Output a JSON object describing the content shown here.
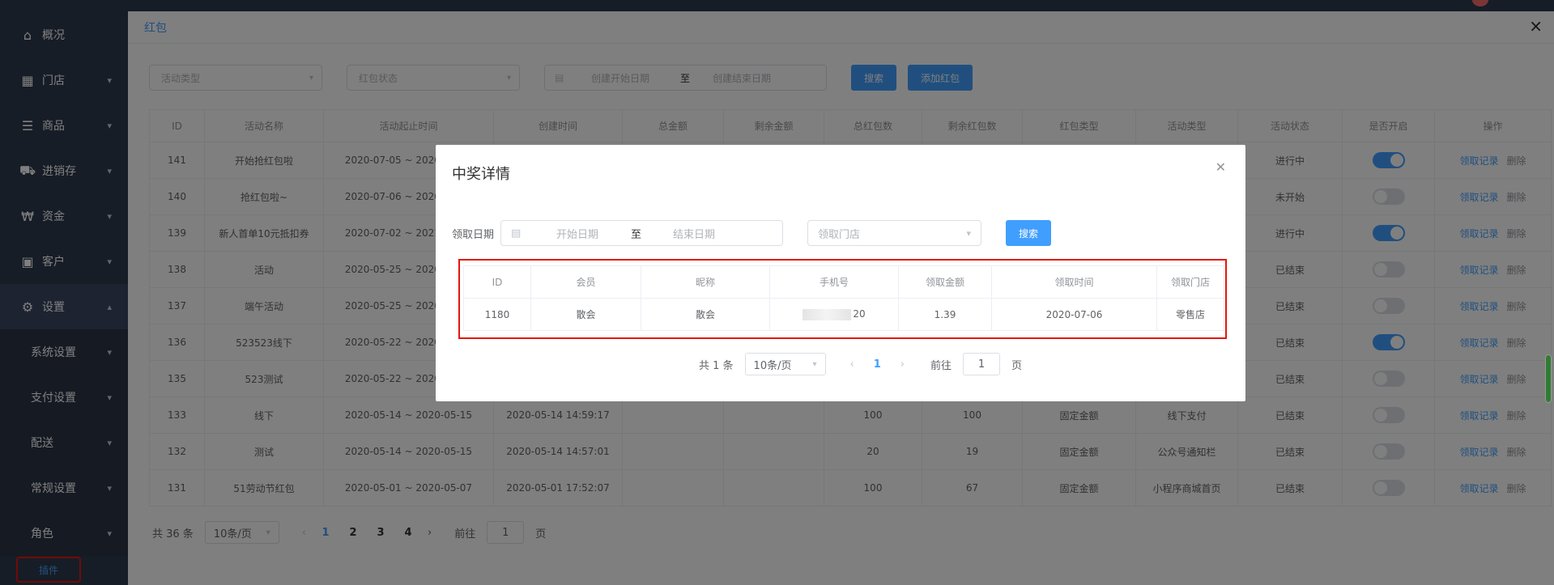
{
  "sidebar": {
    "items": [
      {
        "label": "概况",
        "icon": "home-icon"
      },
      {
        "label": "门店",
        "icon": "building-icon"
      },
      {
        "label": "商品",
        "icon": "list-icon"
      },
      {
        "label": "进销存",
        "icon": "truck-icon"
      },
      {
        "label": "资金",
        "icon": "currency-icon"
      },
      {
        "label": "客户",
        "icon": "id-card-icon"
      },
      {
        "label": "设置",
        "icon": "gear-icon"
      }
    ],
    "sub_items": [
      "系统设置",
      "支付设置",
      "配送",
      "常规设置",
      "角色"
    ],
    "plugin_label": "插件"
  },
  "drawer": {
    "title": "红包",
    "close": "×"
  },
  "filters": {
    "activity_type": "活动类型",
    "status": "红包状态",
    "start_date": "创建开始日期",
    "to": "至",
    "end_date": "创建结束日期",
    "search": "搜索",
    "add": "添加红包"
  },
  "table": {
    "headers": [
      "ID",
      "活动名称",
      "活动起止时间",
      "创建时间",
      "总金额",
      "剩余金额",
      "总红包数",
      "剩余红包数",
      "红包类型",
      "活动类型",
      "活动状态",
      "是否开启",
      "操作"
    ],
    "rows": [
      {
        "id": "141",
        "name": "开始抢红包啦",
        "period": "2020-07-05 ~ 2020-07-10",
        "created": "",
        "total": "",
        "remain": "",
        "count": "",
        "remain_count": "",
        "type": "",
        "act": "",
        "status": "进行中",
        "on": true
      },
      {
        "id": "140",
        "name": "抢红包啦~",
        "period": "2020-07-06 ~ 2020-07-11",
        "created": "",
        "total": "",
        "remain": "",
        "count": "",
        "remain_count": "",
        "type": "",
        "act": "",
        "status": "未开始",
        "on": false
      },
      {
        "id": "139",
        "name": "新人首单10元抵扣券",
        "period": "2020-07-02 ~ 2021-07-02",
        "created": "",
        "total": "",
        "remain": "",
        "count": "",
        "remain_count": "",
        "type": "",
        "act": "",
        "status": "进行中",
        "on": true
      },
      {
        "id": "138",
        "name": "活动",
        "period": "2020-05-25 ~ 2020-05-30",
        "created": "",
        "total": "",
        "remain": "",
        "count": "",
        "remain_count": "",
        "type": "",
        "act": "",
        "status": "已结束",
        "on": false
      },
      {
        "id": "137",
        "name": "端午活动",
        "period": "2020-05-25 ~ 2020-05-30",
        "created": "",
        "total": "",
        "remain": "",
        "count": "",
        "remain_count": "",
        "type": "",
        "act": "",
        "status": "已结束",
        "on": false
      },
      {
        "id": "136",
        "name": "523523线下",
        "period": "2020-05-22 ~ 2020-05-23",
        "created": "",
        "total": "",
        "remain": "",
        "count": "",
        "remain_count": "",
        "type": "",
        "act": "",
        "status": "已结束",
        "on": true
      },
      {
        "id": "135",
        "name": "523测试",
        "period": "2020-05-22 ~ 2020-05-23",
        "created": "",
        "total": "",
        "remain": "",
        "count": "",
        "remain_count": "",
        "type": "",
        "act": "",
        "status": "已结束",
        "on": false
      },
      {
        "id": "133",
        "name": "线下",
        "period": "2020-05-14 ~ 2020-05-15",
        "created": "2020-05-14 14:59:17",
        "total": "",
        "remain": "",
        "count": "100",
        "remain_count": "100",
        "type": "固定金额",
        "act": "线下支付",
        "status": "已结束",
        "on": false
      },
      {
        "id": "132",
        "name": "测试",
        "period": "2020-05-14 ~ 2020-05-15",
        "created": "2020-05-14 14:57:01",
        "total": "",
        "remain": "",
        "count": "20",
        "remain_count": "19",
        "type": "固定金额",
        "act": "公众号通知栏",
        "status": "已结束",
        "on": false
      },
      {
        "id": "131",
        "name": "51劳动节红包",
        "period": "2020-05-01 ~ 2020-05-07",
        "created": "2020-05-01 17:52:07",
        "total": "",
        "remain": "",
        "count": "100",
        "remain_count": "67",
        "type": "固定金额",
        "act": "小程序商城首页",
        "status": "已结束",
        "on": false
      }
    ],
    "op_records": "领取记录",
    "op_delete": "删除"
  },
  "pager": {
    "total": "共 36 条",
    "size": "10条/页",
    "pages": [
      "1",
      "2",
      "3",
      "4"
    ],
    "goto": "前往",
    "page_value": "1",
    "page_unit": "页"
  },
  "dialog": {
    "title": "中奖详情",
    "date_label": "领取日期",
    "start": "开始日期",
    "to": "至",
    "end": "结束日期",
    "store_placeholder": "领取门店",
    "search": "搜索",
    "headers": [
      "ID",
      "会员",
      "昵称",
      "手机号",
      "领取金额",
      "领取时间",
      "领取门店"
    ],
    "rows": [
      {
        "id": "1180",
        "member": "散会",
        "nick": "散会",
        "phone_tail": "20",
        "amount": "1.39",
        "time": "2020-07-06",
        "store": "零售店"
      }
    ],
    "total": "共 1 条",
    "size": "10条/页",
    "page": "1",
    "goto": "前往",
    "page_value": "1",
    "page_unit": "页"
  }
}
